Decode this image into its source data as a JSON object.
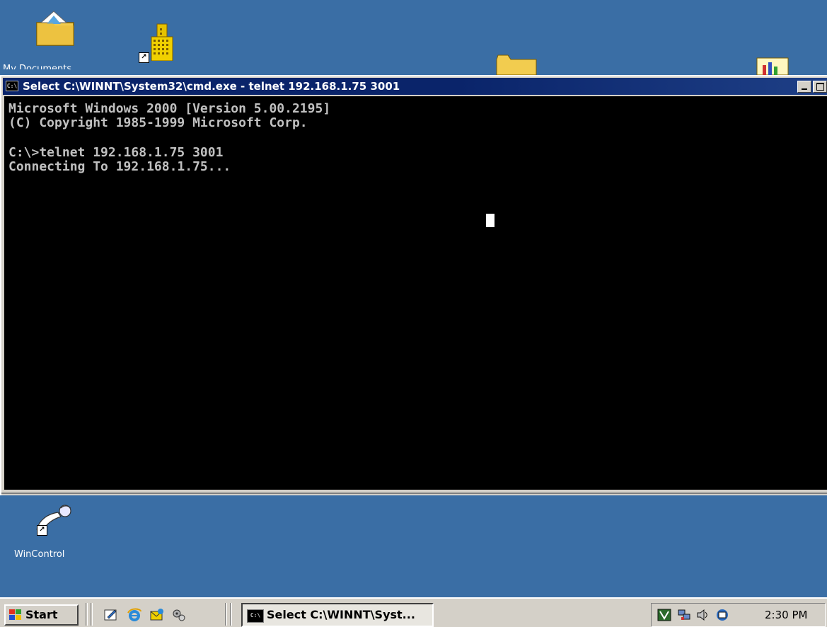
{
  "desktop": {
    "icons": [
      {
        "label": "My Documents"
      },
      {
        "label": "WinControl"
      }
    ]
  },
  "window": {
    "title": "Select C:\\WINNT\\System32\\cmd.exe - telnet 192.168.1.75 3001",
    "icon_text": "C:\\"
  },
  "console": {
    "lines": [
      "Microsoft Windows 2000 [Version 5.00.2195]",
      "(C) Copyright 1985-1999 Microsoft Corp.",
      "",
      "C:\\>telnet 192.168.1.75 3001",
      "Connecting To 192.168.1.75..."
    ]
  },
  "taskbar": {
    "start_label": "Start",
    "task_button_label": "Select C:\\WINNT\\Syst...",
    "clock": "2:30 PM"
  },
  "colors": {
    "desktop": "#3a6ea5",
    "titlebar": "#0a246a",
    "console_bg": "#000000",
    "console_text": "#c0c0c0",
    "chrome": "#d4d0c8"
  }
}
